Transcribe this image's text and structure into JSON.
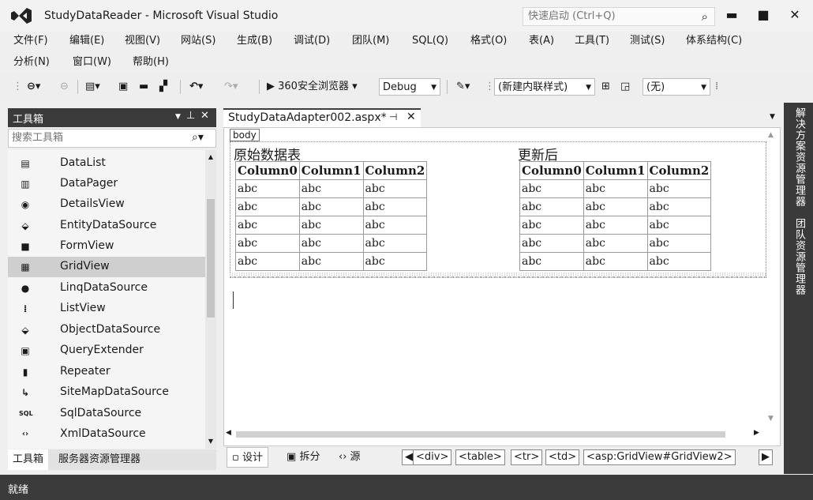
{
  "window": {
    "title": "StudyDataReader - Microsoft Visual Studio",
    "quick_launch_placeholder": "快速启动 (Ctrl+Q)",
    "minimize": "▬",
    "maximize": "■",
    "close": "✕"
  },
  "menu": {
    "row1": [
      "文件(F)",
      "编辑(E)",
      "视图(V)",
      "网站(S)",
      "生成(B)",
      "调试(D)",
      "团队(M)",
      "SQL(Q)",
      "格式(O)",
      "表(A)",
      "工具(T)",
      "测试(S)",
      "体系结构(C)"
    ],
    "row2": [
      "分析(N)",
      "窗口(W)",
      "帮助(H)"
    ]
  },
  "toolbar": {
    "browser_label": "360安全浏览器",
    "config_value": "Debug",
    "style_value": "(新建内联样式)",
    "target_value": "(无)"
  },
  "toolbox": {
    "title": "工具箱",
    "search_placeholder": "搜索工具箱",
    "items": [
      {
        "icon": "datalist-icon",
        "glyph": "▤",
        "label": "DataList"
      },
      {
        "icon": "datapager-icon",
        "glyph": "▥",
        "label": "DataPager"
      },
      {
        "icon": "detailsview-icon",
        "glyph": "◉",
        "label": "DetailsView"
      },
      {
        "icon": "entitydatasource-icon",
        "glyph": "⬙",
        "label": "EntityDataSource"
      },
      {
        "icon": "formview-icon",
        "glyph": "■",
        "label": "FormView"
      },
      {
        "icon": "gridview-icon",
        "glyph": "▦",
        "label": "GridView"
      },
      {
        "icon": "linqdatasource-icon",
        "glyph": "●",
        "label": "LinqDataSource"
      },
      {
        "icon": "listview-icon",
        "glyph": "⁞",
        "label": "ListView"
      },
      {
        "icon": "objectdatasource-icon",
        "glyph": "⬙",
        "label": "ObjectDataSource"
      },
      {
        "icon": "queryextender-icon",
        "glyph": "▣",
        "label": "QueryExtender"
      },
      {
        "icon": "repeater-icon",
        "glyph": "▮",
        "label": "Repeater"
      },
      {
        "icon": "sitemapdatasource-icon",
        "glyph": "↳",
        "label": "SiteMapDataSource"
      },
      {
        "icon": "sqldatasource-icon",
        "glyph": "SQL",
        "label": "SqlDataSource"
      },
      {
        "icon": "xmldatasource-icon",
        "glyph": "‹›",
        "label": "XmlDataSource"
      }
    ],
    "selected_item": "GridView",
    "bottom_tabs": [
      "工具箱",
      "服务器资源管理器"
    ]
  },
  "document": {
    "tab_title": "StudyDataAdapter002.aspx*",
    "body_tag": "body",
    "left_grid": {
      "caption": "原始数据表",
      "columns": [
        "Column0",
        "Column1",
        "Column2"
      ],
      "rows": [
        [
          "abc",
          "abc",
          "abc"
        ],
        [
          "abc",
          "abc",
          "abc"
        ],
        [
          "abc",
          "abc",
          "abc"
        ],
        [
          "abc",
          "abc",
          "abc"
        ],
        [
          "abc",
          "abc",
          "abc"
        ]
      ]
    },
    "right_grid": {
      "caption": "更新后",
      "columns": [
        "Column0",
        "Column1",
        "Column2"
      ],
      "rows": [
        [
          "abc",
          "abc",
          "abc"
        ],
        [
          "abc",
          "abc",
          "abc"
        ],
        [
          "abc",
          "abc",
          "abc"
        ],
        [
          "abc",
          "abc",
          "abc"
        ],
        [
          "abc",
          "abc",
          "abc"
        ]
      ]
    }
  },
  "view_bar": {
    "design": "设计",
    "split": "拆分",
    "source": "源",
    "breadcrumbs": [
      "<div>",
      "<table>",
      "<tr>",
      "<td>",
      "<asp:GridView#GridView2>"
    ]
  },
  "side_panel": {
    "tabs": [
      "解决方案资源管理器",
      "团队资源管理器"
    ]
  },
  "status": {
    "text": "就绪"
  }
}
